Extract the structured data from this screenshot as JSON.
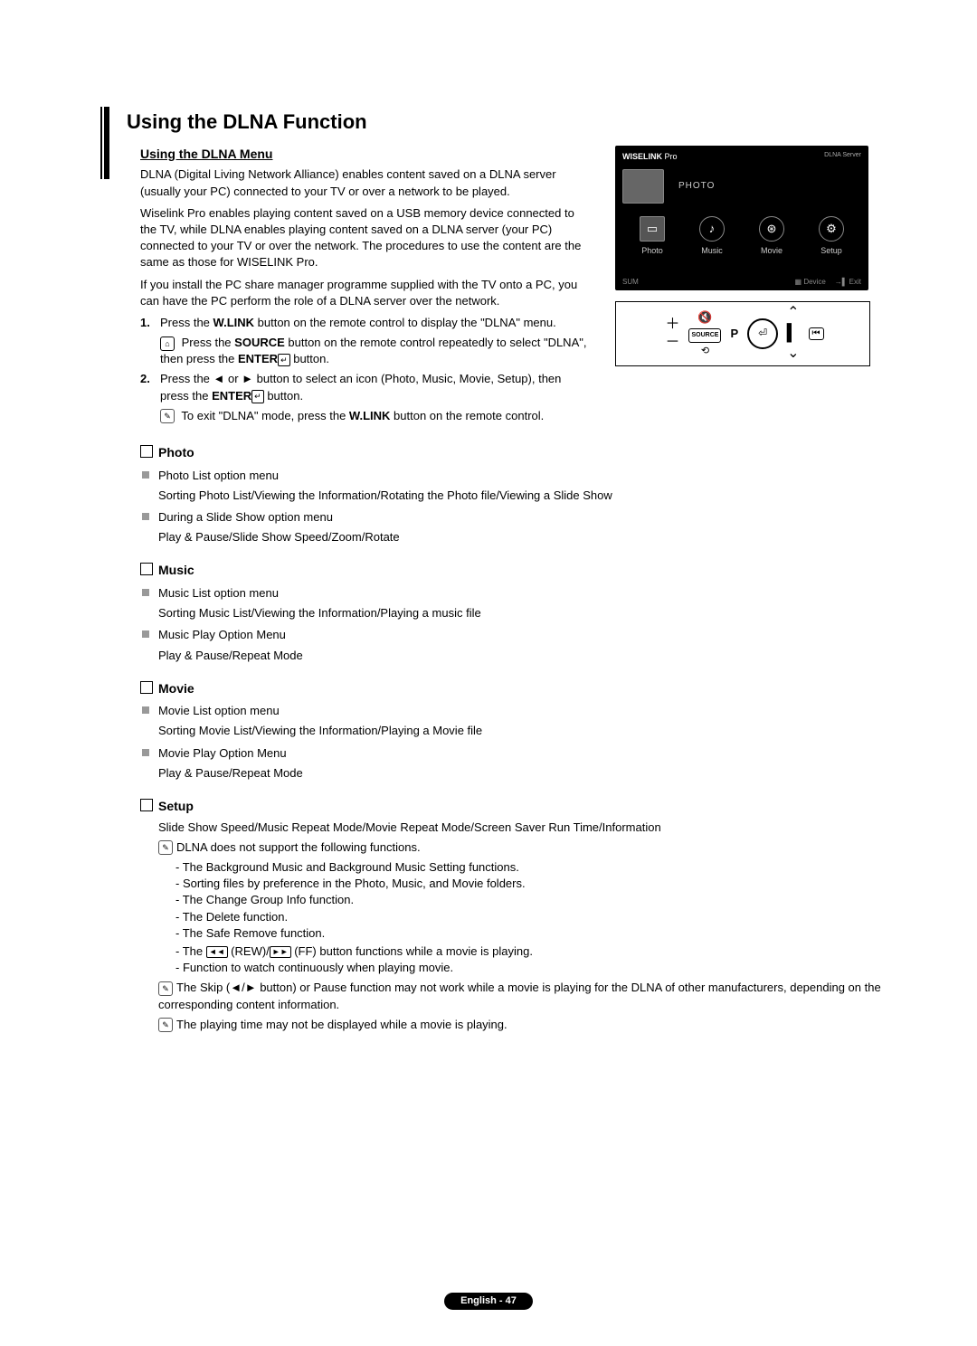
{
  "title": "Using the DLNA Function",
  "subtitle": "Using the DLNA Menu",
  "intro1": "DLNA (Digital Living Network Alliance) enables content saved on a DLNA server (usually your PC) connected to your TV or over a network to be played.",
  "intro2": "Wiselink Pro enables playing content saved on a USB memory device connected to the TV, while DLNA enables playing content saved on a DLNA server (your PC) connected to your TV or over the network. The procedures to use the content are the same as those for WISELINK Pro.",
  "intro3": "If you install the PC share manager programme supplied with the TV onto a PC, you can have the PC perform the role of a DLNA server over the network.",
  "step1_pre": "Press the ",
  "step1_wlink": "W.LINK",
  "step1_post": " button on the remote control to display the \"DLNA\" menu.",
  "step1r_pre": "Press the ",
  "step1r_source": "SOURCE",
  "step1r_mid": " button on the remote control repeatedly to select \"DLNA\", then press the ",
  "step1r_enter": "ENTER",
  "step1r_post": " button.",
  "step2_pre": "Press the ◄ or ► button to select an icon (Photo, Music, Movie, Setup), then press the ",
  "step2_enter": "ENTER",
  "step2_post": " button.",
  "step2note_pre": "To exit \"DLNA\" mode, press the ",
  "step2note_wlink": "W.LINK",
  "step2note_post": " button on the remote control.",
  "sections": {
    "photo": {
      "title": "Photo",
      "items": [
        {
          "head": "Photo List option menu",
          "body": "Sorting Photo List/Viewing the Information/Rotating the Photo file/Viewing a Slide Show"
        },
        {
          "head": "During a Slide Show option menu",
          "body": "Play & Pause/Slide Show Speed/Zoom/Rotate"
        }
      ]
    },
    "music": {
      "title": "Music",
      "items": [
        {
          "head": "Music List option menu",
          "body": "Sorting Music List/Viewing the Information/Playing a music file"
        },
        {
          "head": "Music Play Option Menu",
          "body": "Play & Pause/Repeat Mode"
        }
      ]
    },
    "movie": {
      "title": "Movie",
      "items": [
        {
          "head": "Movie List option menu",
          "body": "Sorting Movie List/Viewing the Information/Playing a Movie file"
        },
        {
          "head": "Movie Play Option Menu",
          "body": "Play & Pause/Repeat Mode"
        }
      ]
    },
    "setup": {
      "title": "Setup",
      "body": "Slide Show Speed/Music Repeat Mode/Movie Repeat Mode/Screen Saver Run Time/Information",
      "note1": "DLNA does not support the following functions.",
      "dashes": [
        "The Background Music and Background Music Setting functions.",
        "Sorting files by preference in the Photo, Music, and Movie folders.",
        "The Change Group Info function.",
        "The Delete function.",
        "The Safe Remove function."
      ],
      "dash_rewff_pre": "The ",
      "dash_rewff_mid": " (REW)/",
      "dash_rewff_post": " (FF) button functions while a movie is playing.",
      "dash_last": "Function to watch continuously when playing movie.",
      "note2": "The Skip (◄/► button) or Pause function may not work while a movie is playing for the DLNA of other manufacturers, depending on the corresponding content information.",
      "note3": "The playing time may not be displayed while a movie is playing."
    }
  },
  "screenshot": {
    "wiselink": "WISELINK",
    "pro": "Pro",
    "dlna_server": "DLNA Server",
    "main_label": "PHOTO",
    "tabs": [
      "Photo",
      "Music",
      "Movie",
      "Setup"
    ],
    "footer_left": "SUM",
    "footer_device": "Device",
    "footer_exit": "Exit"
  },
  "remote": {
    "source": "SOURCE",
    "p": "P"
  },
  "footer": {
    "lang": "English - 47"
  }
}
